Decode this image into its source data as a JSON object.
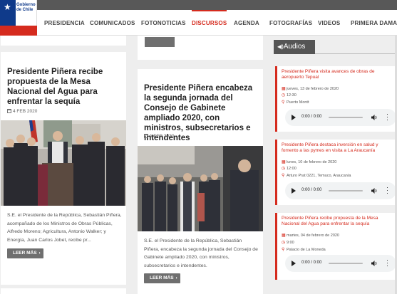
{
  "header": {
    "logo_text": "Gobierno de Chile",
    "nav": [
      {
        "label": "PRESIDENCIA",
        "active": false
      },
      {
        "label": "COMUNICADOS",
        "active": false
      },
      {
        "label": "FOTONOTICIAS",
        "active": false
      },
      {
        "label": "DISCURSOS",
        "active": true
      },
      {
        "label": "AGENDA",
        "active": false
      },
      {
        "label": "FOTOGRAFÍAS",
        "active": false
      },
      {
        "label": "VIDEOS",
        "active": false
      },
      {
        "label": "PRIMERA DAMA",
        "active": false
      }
    ]
  },
  "articles": [
    {
      "title": "Presidente Piñera recibe propuesta de la Mesa Nacional del Agua para enfrentar la sequía",
      "date": "4 FEB 2020",
      "description": "S.E. el Presidente de la República, Sebastián Piñera, acompañado de los Ministros de Obras Públicas, Alfredo Moreno; Agricultura, Antonio Walker; y Energía, Juan Carlos Jobet, recibe pr...",
      "button": "LEER MÁS"
    },
    {
      "title": "Presidente Piñera encabeza la segunda jornada del Consejo de Gabinete ampliado 2020, con ministros, subsecretarios e intendentes",
      "date": "1 FEB 2020",
      "description": "S.E. el Presidente de la República, Sebastián Piñera, encabeza la segunda jornada del Consejo de Gabinete ampliado 2020, con ministros, subsecretarios e intendentes.",
      "button": "LEER MÁS"
    }
  ],
  "sidebar": {
    "title": "Audios",
    "audios": [
      {
        "title": "Presidente Piñera visita avances de obras de aeropuerto Tepual",
        "date": "jueves, 13 de febrero de 2020",
        "time": "12:30",
        "place": "Puerto Montt",
        "player_time": "0:00 / 0:00"
      },
      {
        "title": "Presidente Piñera destaca inversión en salud y fomento a las pymes en visita a La Araucanía",
        "date": "lunes, 10 de febrero de 2020",
        "time": "12:00",
        "place": "Arturo Prat 0221, Temuco, Araucanía",
        "player_time": "0:00 / 0:00"
      },
      {
        "title": "Presidente Piñera recibe propuesta de la Mesa Nacional del Agua para enfrentar la sequía",
        "date": "martes, 04 de febrero de 2020",
        "time": "9:00",
        "place": "Palacio de La Moneda",
        "player_time": "0:00 / 0:00"
      }
    ]
  },
  "colors": {
    "accent": "#d52b1e",
    "flag_blue": "#0f3a8a",
    "button": "#6f6f6f"
  }
}
